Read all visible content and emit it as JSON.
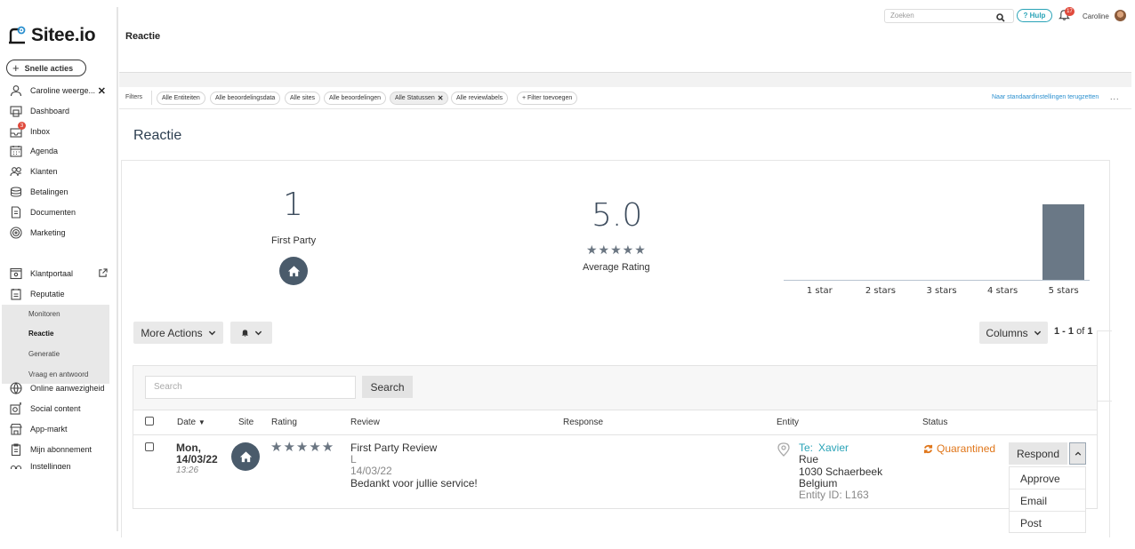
{
  "app": {
    "logo_text": "Sitee.io",
    "quick_actions": "Snelle acties"
  },
  "sidebar": {
    "items": [
      {
        "label": "Caroline weerge...",
        "icon": "user-icon"
      },
      {
        "label": "Dashboard",
        "icon": "dashboard-icon"
      },
      {
        "label": "Inbox",
        "icon": "inbox-icon",
        "badge": "3"
      },
      {
        "label": "Agenda",
        "icon": "calendar-icon"
      },
      {
        "label": "Klanten",
        "icon": "customers-icon"
      },
      {
        "label": "Betalingen",
        "icon": "payments-icon"
      },
      {
        "label": "Documenten",
        "icon": "document-icon"
      },
      {
        "label": "Marketing",
        "icon": "target-icon"
      },
      {
        "label": "Klantportaal",
        "icon": "portal-icon"
      },
      {
        "label": "Reputatie",
        "icon": "reputation-icon"
      },
      {
        "label": "Online aanwezigheid",
        "icon": "globe-icon"
      },
      {
        "label": "Social content",
        "icon": "social-icon"
      },
      {
        "label": "App-markt",
        "icon": "store-icon"
      },
      {
        "label": "Mijn abonnement",
        "icon": "subscription-icon"
      },
      {
        "label": "Instellingen",
        "icon": "settings-icon"
      }
    ],
    "submenu": [
      "Monitoren",
      "Reactie",
      "Generatie",
      "Vraag en antwoord"
    ],
    "submenu_active": "Reactie"
  },
  "topbar": {
    "title": "Reactie",
    "search_placeholder": "Zoeken",
    "help": "? Hulp",
    "notification_count": "17",
    "user": "Caroline"
  },
  "filters": {
    "label": "Filters",
    "chips": [
      "Alle Entiteiten",
      "Alle beoordelingsdata",
      "Alle sites",
      "Alle beoordelingen",
      "Alle Statussen",
      "Alle reviewlabels"
    ],
    "add": "+ Filter toevoegen",
    "reset": "Naar standaardinstellingen terugzetten",
    "more": "..."
  },
  "page": {
    "heading": "Reactie"
  },
  "stats": {
    "first_party_count": "1",
    "first_party_label": "First Party",
    "average": "5.0",
    "average_stars": "★★★★★",
    "average_label": "Average Rating"
  },
  "chart_data": {
    "type": "bar",
    "categories": [
      "1 star",
      "2 stars",
      "3 stars",
      "4 stars",
      "5 stars"
    ],
    "values": [
      0,
      0,
      0,
      0,
      1
    ],
    "ylim": [
      0,
      1
    ]
  },
  "actions": {
    "more_actions": "More Actions",
    "columns": "Columns",
    "pager_range": "1 - 1",
    "pager_of": "of",
    "pager_total": "1"
  },
  "table": {
    "search_placeholder": "Search",
    "search_button": "Search",
    "headers": {
      "date": "Date",
      "site": "Site",
      "rating": "Rating",
      "review": "Review",
      "response": "Response",
      "entity": "Entity",
      "status": "Status"
    },
    "row": {
      "day": "Mon,",
      "date": "14/03/22",
      "time": "13:26",
      "rating": "★★★★★",
      "review_title": "First Party Review",
      "review_author": "L",
      "review_date": "14/03/22",
      "review_text": "Bedankt voor jullie service!",
      "entity_prefix": "Te:",
      "entity_name": "Xavier",
      "entity_street": "Rue",
      "entity_city": "1030 Schaerbeek",
      "entity_country": "Belgium",
      "entity_id": "Entity ID: L163",
      "status": "Quarantined",
      "respond": "Respond"
    },
    "respond_options": [
      "Approve",
      "Email",
      "Post"
    ]
  },
  "colors": {
    "accent": "#29a3b7",
    "quarantined": "#e0761a",
    "bar": "#6a7886",
    "badge": "#e04a3c"
  }
}
